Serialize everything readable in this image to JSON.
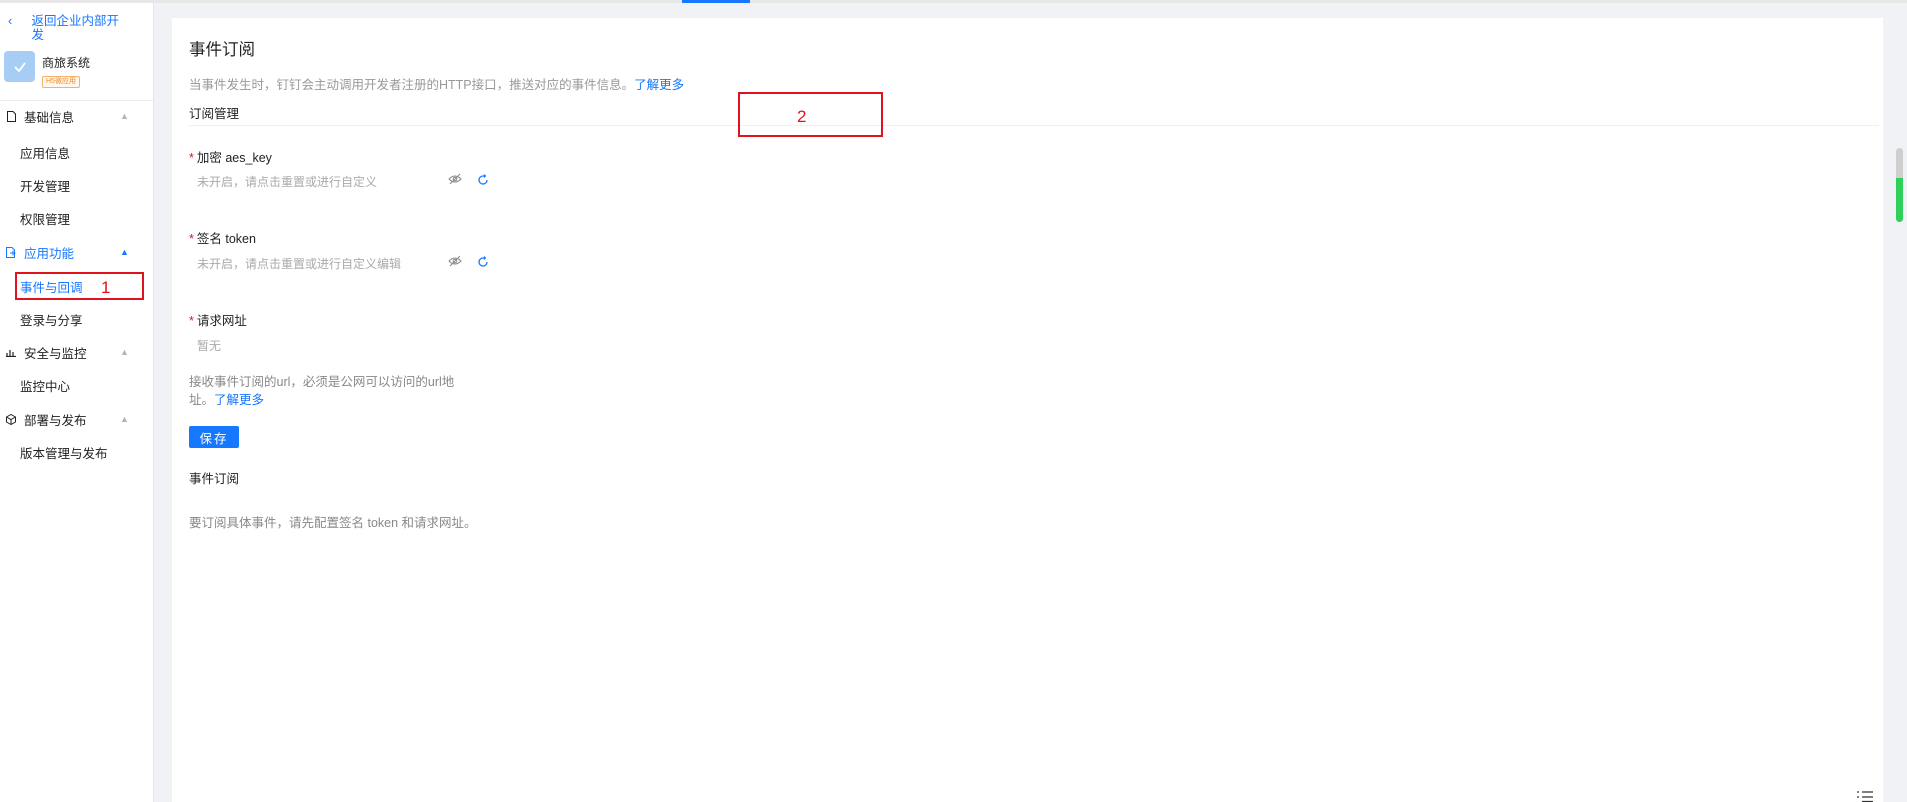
{
  "sidebar": {
    "back_label": "返回企业内部开发",
    "app": {
      "name": "商旅系统",
      "badge": "H5微应用"
    },
    "groups": [
      {
        "label": "基础信息",
        "items": [
          "应用信息",
          "开发管理",
          "权限管理"
        ]
      },
      {
        "label": "应用功能",
        "items": [
          "事件与回调",
          "登录与分享"
        ]
      },
      {
        "label": "安全与监控",
        "items": [
          "监控中心"
        ]
      },
      {
        "label": "部署与发布",
        "items": [
          "版本管理与发布"
        ]
      }
    ],
    "active_item": "事件与回调"
  },
  "annotations": [
    "1",
    "2"
  ],
  "main": {
    "title": "事件订阅",
    "description": "当事件发生时，钉钉会主动调用开发者注册的HTTP接口，推送对应的事件信息。",
    "learn_more": "了解更多",
    "subscription_section": "订阅管理",
    "fields": [
      {
        "label": "加密 aes_key",
        "value": "未开启，请点击重置或进行自定义"
      },
      {
        "label": "签名 token",
        "value": "未开启，请点击重置或进行自定义编辑"
      },
      {
        "label": "请求网址",
        "value": "暂无"
      }
    ],
    "url_help": "接收事件订阅的url，必须是公网可以访问的url地址。",
    "url_help_link": "了解更多",
    "save_label": "保存",
    "event_section": "事件订阅",
    "event_note": "要订阅具体事件，请先配置签名 token 和请求网址。"
  },
  "colors": {
    "accent": "#1677ff",
    "marker": "#e0121e",
    "required": "#e0121e"
  }
}
